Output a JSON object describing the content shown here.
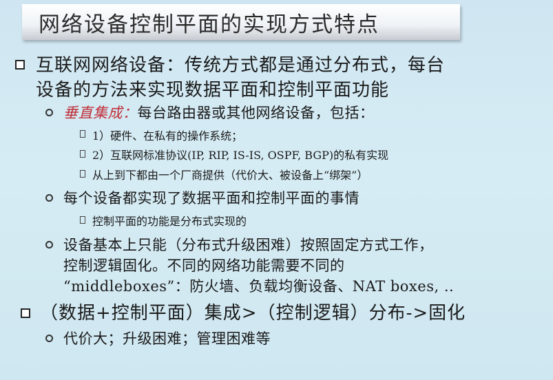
{
  "title": "网络设备控制平面的实现方式特点",
  "bullets": {
    "b1_line1": "互联网网络设备：传统方式都是通过分布式，每台",
    "b1_line2": "设备的方法来实现数据平面和控制平面功能",
    "s1_red": "垂直集成：",
    "s1_rest": "每台路由器或其他网络设备，包括：",
    "t1": "1）硬件、在私有的操作系统；",
    "t2": "2）互联网标准协议(IP, RIP, IS-IS, OSPF, BGP)的私有实现",
    "t3": "从上到下都由一个厂商提供（代价大、被设备上“绑架”）",
    "s2": "每个设备都实现了数据平面和控制平面的事情",
    "t4": "控制平面的功能是分布式实现的",
    "s3_line1": "设备基本上只能（分布式升级困难）按照固定方式工作，",
    "s3_line2": "控制逻辑固化。不同的网络功能需要不同的",
    "s3_line3": "“middleboxes”：防火墙、负载均衡设备、NAT boxes, ..",
    "b2": "（数据+控制平面）集成>（控制逻辑）分布->固化",
    "s4": "代价大；升级困难；管理困难等"
  }
}
